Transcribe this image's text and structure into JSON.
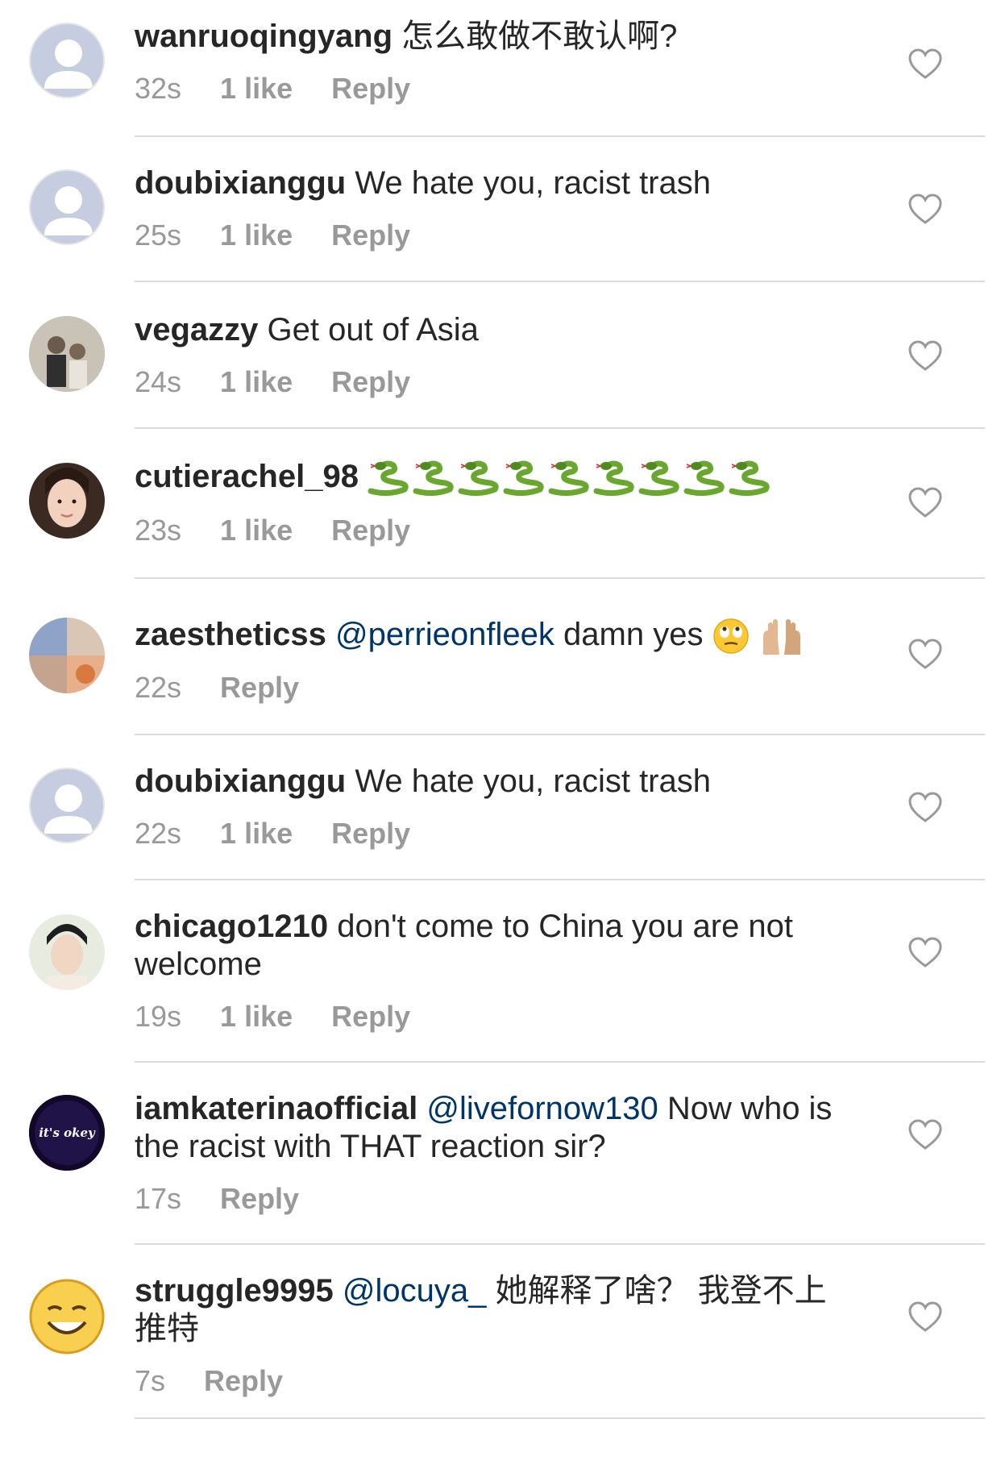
{
  "comments": [
    {
      "username": "wanruoqingyang",
      "text": "怎么敢做不敢认啊?",
      "time": "32s",
      "likes": "1 like",
      "reply": "Reply",
      "avatar": "default"
    },
    {
      "username": "doubixianggu",
      "text": "We hate you, racist trash",
      "time": "25s",
      "likes": "1 like",
      "reply": "Reply",
      "avatar": "default"
    },
    {
      "username": "vegazzy",
      "text": "Get out of Asia",
      "time": "24s",
      "likes": "1 like",
      "reply": "Reply",
      "avatar": "couple-photo"
    },
    {
      "username": "cutierachel_98",
      "text": "",
      "time": "23s",
      "likes": "1 like",
      "reply": "Reply",
      "avatar": "girl-photo",
      "emoji": "snake",
      "emoji_count": 9
    },
    {
      "username": "zaestheticss",
      "mention": "@perrieonfleek",
      "text": "damn yes",
      "time": "22s",
      "reply": "Reply",
      "avatar": "collage-photo",
      "emojis": [
        "eye-roll-face",
        "raising-hands"
      ]
    },
    {
      "username": "doubixianggu",
      "text": "We hate you, racist trash",
      "time": "22s",
      "likes": "1 like",
      "reply": "Reply",
      "avatar": "default"
    },
    {
      "username": "chicago1210",
      "text": "don't come to China you are not welcome",
      "time": "19s",
      "likes": "1 like",
      "reply": "Reply",
      "avatar": "boy-photo"
    },
    {
      "username": "iamkaterinaofficial",
      "mention": "@livefornow130",
      "text": "Now who is the racist with THAT reaction sir?",
      "time": "17s",
      "reply": "Reply",
      "avatar": "its-okey-badge",
      "avatar_text": "it's okey"
    },
    {
      "username": "struggle9995",
      "mention": "@locuya_",
      "text": "她解释了啥？ 我登不上推特",
      "time": "7s",
      "reply": "Reply",
      "avatar": "smiley-face"
    }
  ],
  "colors": {
    "username": "#262626",
    "mention": "#003569",
    "meta": "#999999",
    "divider": "#dbdbdb",
    "avatar_default": "#c7cde0"
  }
}
